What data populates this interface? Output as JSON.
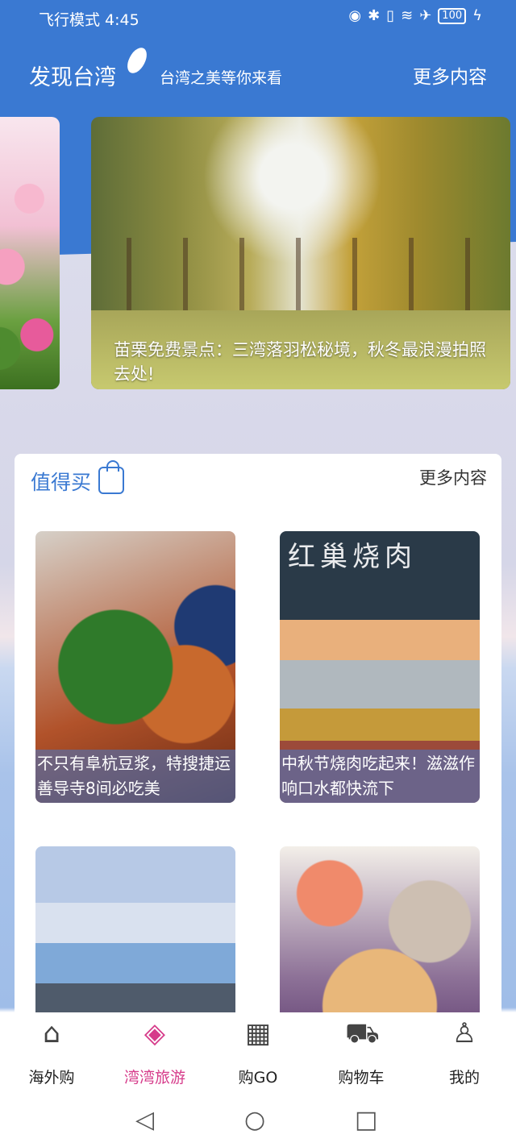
{
  "status": {
    "time": "飞行模式 4:45",
    "battery": "100"
  },
  "header": {
    "title": "发现台湾",
    "subtitle": "台湾之美等你来看",
    "more": "更多内容"
  },
  "carousel": {
    "left_caption": "一",
    "main_caption": "苗栗免费景点：三湾落羽松秘境，秋冬最浪漫拍照去处!"
  },
  "buy": {
    "title": "值得买",
    "more": "更多内容",
    "items": [
      {
        "caption": "不只有阜杭豆浆，特搜捷运善导寺8间必吃美"
      },
      {
        "caption": "中秋节烧肉吃起来！滋滋作响口水都快流下",
        "sign": "红巢烧肉"
      },
      {
        "caption": ""
      },
      {
        "caption": ""
      }
    ]
  },
  "nav": {
    "items": [
      {
        "label": "海外购",
        "icon": "home-icon"
      },
      {
        "label": "湾湾旅游",
        "icon": "travel-icon"
      },
      {
        "label": "购GO",
        "icon": "store-icon"
      },
      {
        "label": "购物车",
        "icon": "cart-icon"
      },
      {
        "label": "我的",
        "icon": "user-icon"
      }
    ],
    "active_color": "#d63b8a"
  },
  "colors": {
    "brand": "#3a79d2"
  }
}
